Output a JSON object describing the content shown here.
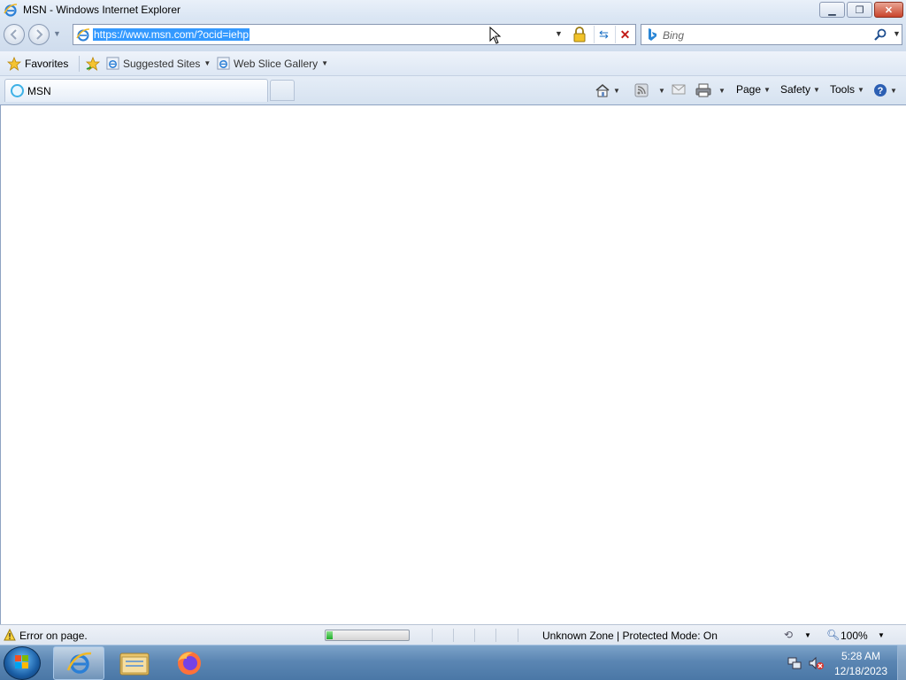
{
  "window": {
    "title": "MSN - Windows Internet Explorer"
  },
  "address": {
    "url": "https://www.msn.com/?ocid=iehp"
  },
  "search": {
    "placeholder": "Bing"
  },
  "favorites": {
    "label": "Favorites",
    "links": [
      {
        "label": "Suggested Sites"
      },
      {
        "label": "Web Slice Gallery"
      }
    ]
  },
  "tabs": [
    {
      "label": "MSN"
    }
  ],
  "commandbar": {
    "page": "Page",
    "safety": "Safety",
    "tools": "Tools"
  },
  "status": {
    "message": "Error on page.",
    "zone": "Unknown Zone | Protected Mode: On",
    "zoom": "100%",
    "progress_fraction": 0.08
  },
  "taskbar": {
    "time": "5:28 AM",
    "date": "12/18/2023"
  },
  "colors": {
    "selection": "#3399ff",
    "progress": "#1fae2a",
    "close_button": "#c9442c"
  }
}
